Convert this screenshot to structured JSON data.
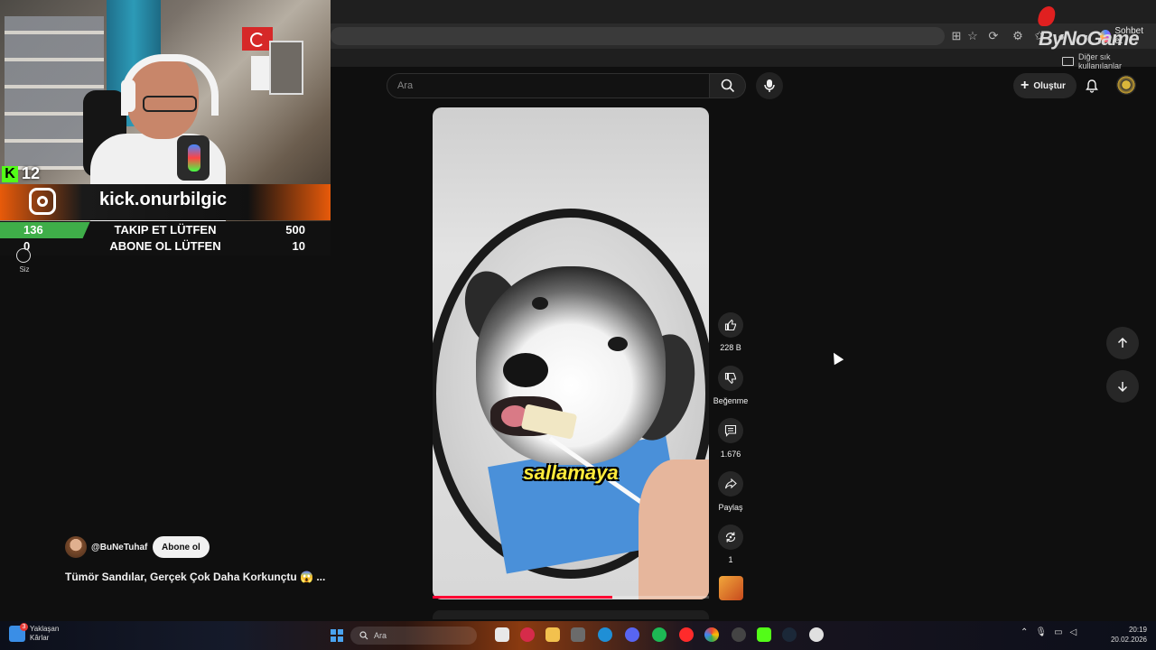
{
  "watermark": "ByNoGame",
  "browser": {
    "chat_button": "Sohbet et",
    "bookmarks_folder": "Diğer sık kullanılanlar"
  },
  "stream_overlay": {
    "kick_count": "12",
    "instagram_handle": "kick.onurbilgic",
    "goals": [
      {
        "current": "136",
        "label": "TAKIP ET LÜTFEN",
        "target": "500",
        "progress": 0.272
      },
      {
        "current": "0",
        "label": "ABONE OL LÜTFEN",
        "target": "10",
        "progress": 0.0
      }
    ],
    "you_label": "Siz"
  },
  "youtube": {
    "search_placeholder": "Ara",
    "create_label": "Oluştur",
    "short": {
      "caption": "sallamaya",
      "channel": "@BuNeTuhaf",
      "subscribe_label": "Abone ol",
      "title": "Tümör Sandılar, Gerçek Çok Daha Korkunçtu 😱 ...",
      "progress": 0.65
    },
    "actions": {
      "like_count": "228 B",
      "dislike_label": "Beğenme",
      "comment_count": "1.676",
      "share_label": "Paylaş",
      "remix_count": "1"
    }
  },
  "taskbar": {
    "weather_line1": "Yaklaşan",
    "weather_line2": "Kârlar",
    "weather_badge": "3",
    "search_label": "Ara",
    "time": "20:19",
    "date": "20.02.2026"
  }
}
